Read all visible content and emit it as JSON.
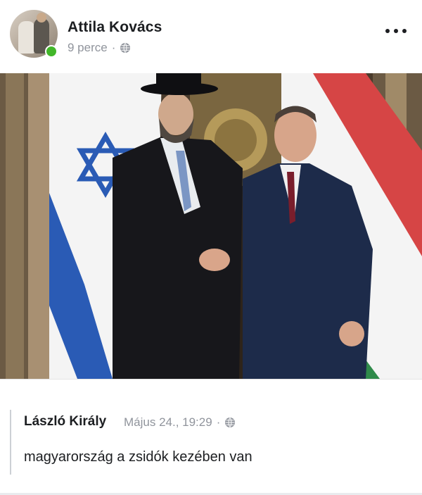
{
  "post": {
    "author": "Attila Kovács",
    "time": "9 perce",
    "separator": "·",
    "privacy_icon": "globe-icon",
    "menu_icon": "more-horizontal-icon",
    "online": true
  },
  "photo": {
    "subject": "Two men in suits shaking hands in front of Israeli and Hungarian flags"
  },
  "comment": {
    "author": "László Király",
    "date": "Május 24., 19:29",
    "separator": "·",
    "privacy_icon": "globe-icon",
    "text": "magyarország a zsidók kezében van"
  },
  "colors": {
    "name": "#1c1e21",
    "meta": "#90949c",
    "online": "#42b72a"
  }
}
